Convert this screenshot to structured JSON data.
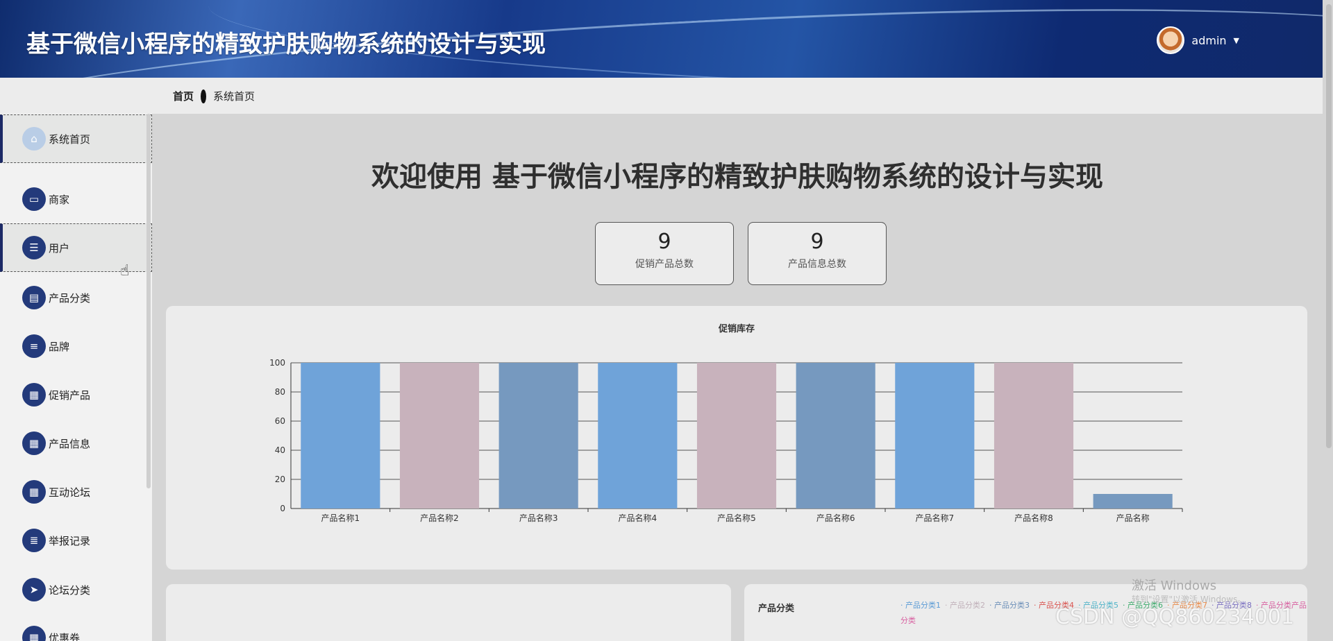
{
  "header": {
    "title": "基于微信小程序的精致护肤购物系统的设计与实现",
    "username": "admin",
    "caret": "▼"
  },
  "breadcrumb": {
    "home": "首页",
    "current": "系统首页"
  },
  "sidebar": {
    "items": [
      {
        "label": "系统首页",
        "icon": "⌂"
      },
      {
        "label": "商家",
        "icon": "▭"
      },
      {
        "label": "用户",
        "icon": "☰"
      },
      {
        "label": "产品分类",
        "icon": "▤"
      },
      {
        "label": "品牌",
        "icon": "≡"
      },
      {
        "label": "促销产品",
        "icon": "▦"
      },
      {
        "label": "产品信息",
        "icon": "▦"
      },
      {
        "label": "互动论坛",
        "icon": "▦"
      },
      {
        "label": "举报记录",
        "icon": "≣"
      },
      {
        "label": "论坛分类",
        "icon": "➤"
      },
      {
        "label": "优惠券",
        "icon": "▦"
      }
    ]
  },
  "main": {
    "welcome": "欢迎使用 基于微信小程序的精致护肤购物系统的设计与实现",
    "stats": [
      {
        "value": "9",
        "label": "促销产品总数"
      },
      {
        "value": "9",
        "label": "产品信息总数"
      }
    ],
    "pie_card": {
      "title": "产品分类",
      "legend": [
        "产品分类1",
        "产品分类2",
        "产品分类3",
        "产品分类4",
        "产品分类5",
        "产品分类6",
        "产品分类7",
        "产品分类8",
        "产品分类产品分类"
      ],
      "legend_colors": [
        "#5b9bd5",
        "#c0b0b9",
        "#6c8fb8",
        "#d9534f",
        "#4fb3c8",
        "#3caa6b",
        "#e88b4b",
        "#7a6fc0",
        "#d85fa0"
      ]
    }
  },
  "chart_data": {
    "type": "bar",
    "title": "促销库存",
    "categories": [
      "产品名称1",
      "产品名称2",
      "产品名称3",
      "产品名称4",
      "产品名称5",
      "产品名称6",
      "产品名称7",
      "产品名称8",
      "产品名称"
    ],
    "values": [
      100,
      100,
      100,
      100,
      100,
      100,
      100,
      100,
      10
    ],
    "ylim": [
      0,
      100
    ],
    "yticks": [
      0,
      20,
      40,
      60,
      80,
      100
    ],
    "colors": [
      "#6fa3d9",
      "#c8b2bc",
      "#7699bf"
    ],
    "grid": true
  },
  "overlay": {
    "activate_windows": "激活 Windows",
    "activate_hint": "转到\"设置\"以激活 Windows。",
    "csdn": "CSDN @QQ860234001"
  }
}
